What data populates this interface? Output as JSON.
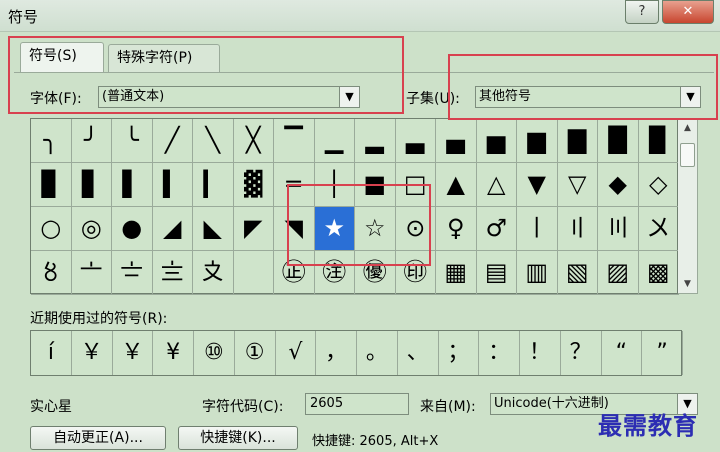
{
  "window": {
    "title": "符号",
    "help": "?",
    "close": "✕"
  },
  "tabs": [
    {
      "label": "符号(S)"
    },
    {
      "label": "特殊字符(P)"
    }
  ],
  "font": {
    "label": "字体(F):",
    "value": "(普通文本)"
  },
  "subset": {
    "label": "子集(U):",
    "value": "其他符号"
  },
  "grid": {
    "rows": [
      [
        "╮",
        "╯",
        "╰",
        "╱",
        "╲",
        "╳",
        "▔",
        "▁",
        "▂",
        "▃",
        "▄",
        "▅",
        "▆",
        "▇",
        "█",
        "▉"
      ],
      [
        "▊",
        "▋",
        "▌",
        "▍",
        "▎",
        "▓",
        "═",
        "│",
        "■",
        "□",
        "▲",
        "△",
        "▼",
        "▽",
        "◆",
        "◇"
      ],
      [
        "○",
        "◎",
        "●",
        "◢",
        "◣",
        "◤",
        "◥",
        "★",
        "☆",
        "⊙",
        "♀",
        "♂",
        "〡",
        "〢",
        "〣",
        "〤"
      ],
      [
        "〥",
        "〦",
        "〧",
        "〨",
        "〩",
        "〪",
        "㊣",
        "㊟",
        "㊝",
        "㊞",
        "▦",
        "▤",
        "▥",
        "▧",
        "▨",
        "▩"
      ]
    ],
    "selected": "★"
  },
  "recent": {
    "label": "近期使用过的符号(R):",
    "symbols": [
      "í",
      "￥",
      "￥",
      "¥",
      "⑩",
      "①",
      "√",
      "，",
      "。",
      "、",
      "；",
      "：",
      "！",
      "？",
      "“",
      "”"
    ]
  },
  "char_name": "实心星",
  "char_code": {
    "label": "字符代码(C):",
    "value": "2605"
  },
  "from": {
    "label": "来自(M):",
    "value": "Unicode(十六进制)"
  },
  "buttons": {
    "autocorrect": "自动更正(A)...",
    "shortcut_key": "快捷键(K)..."
  },
  "shortcut_text": "快捷键: 2605, Alt+X",
  "watermark": "最需教育",
  "colors": {
    "selection": "#2a6fd6",
    "highlight": "#d8414f",
    "bg": "#cde1c9"
  }
}
